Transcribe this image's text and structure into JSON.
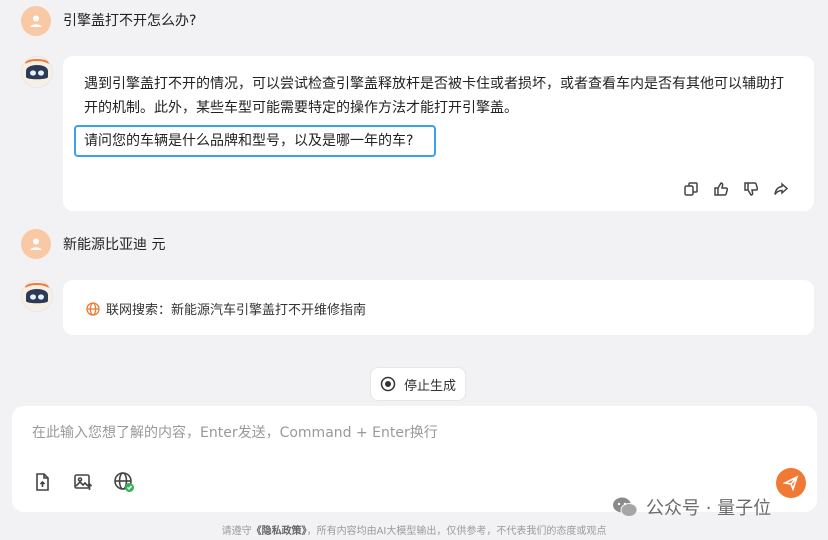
{
  "conversation": {
    "user_message_1": "引擎盖打不开怎么办?",
    "answer_1_paragraph": "遇到引擎盖打不开的情况，可以尝试检查引擎盖释放杆是否被卡住或者损坏，或者查看车内是否有其他可以辅助打开的机制。此外，某些车型可能需要特定的操作方法才能打开引擎盖。",
    "answer_1_question": "请问您的车辆是什么品牌和型号，以及是哪一年的车?",
    "user_message_2": "新能源比亚迪 元",
    "web_search_label": "联网搜索：新能源汽车引擎盖打不开维修指南"
  },
  "actions": {
    "icons": [
      "copy-icon",
      "thumbs-up-icon",
      "thumbs-down-icon",
      "share-icon"
    ]
  },
  "stop_button": {
    "label": "停止生成"
  },
  "composer": {
    "placeholder": "在此输入您想了解的内容，Enter发送，Command + Enter换行",
    "tools": [
      "upload-file-icon",
      "upload-image-icon",
      "web-search-toggle-icon"
    ]
  },
  "watermark": {
    "text": "公众号 · 量子位"
  },
  "footer": {
    "prefix": "请遵守",
    "policy_link": "《隐私政策》",
    "suffix": "，所有内容均由AI大模型输出，仅供参考，不代表我们的态度或观点"
  },
  "colors": {
    "accent": "#f07a35",
    "highlight_border": "#3ba0e6",
    "background": "#f2f2f4",
    "user_avatar": "#f8c9a4"
  }
}
